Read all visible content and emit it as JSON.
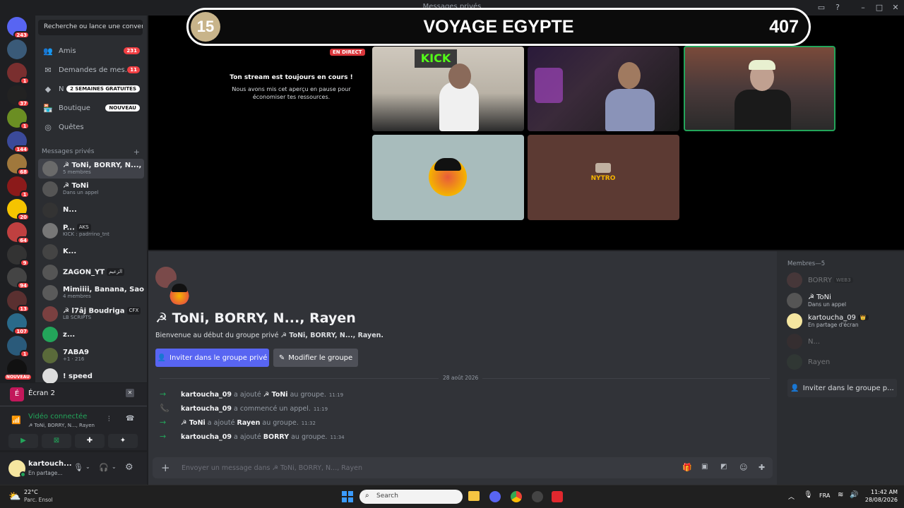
{
  "window": {
    "title": "Messages privés"
  },
  "rail": {
    "servers": [
      {
        "badge": "243",
        "color": "#5865f2",
        "y": 0
      },
      {
        "badge": "",
        "color": "#3a5a78",
        "y": 0
      },
      {
        "badge": "1",
        "color": "#7a2f2f",
        "y": 0
      },
      {
        "badge": "37",
        "color": "#222",
        "y": 0
      },
      {
        "badge": "1",
        "color": "#6b8e23",
        "y": 0
      },
      {
        "badge": "144",
        "color": "#3b4a9a",
        "y": 0
      },
      {
        "badge": "68",
        "color": "#a0783c",
        "y": 0
      },
      {
        "badge": "1",
        "color": "#8b1a1a",
        "y": 0
      },
      {
        "badge": "20",
        "color": "#f5c400",
        "y": 0
      },
      {
        "badge": "64",
        "color": "#c04040",
        "y": 0
      },
      {
        "badge": "9",
        "color": "#333",
        "y": 0
      },
      {
        "badge": "94",
        "color": "#444",
        "y": 0
      },
      {
        "badge": "13",
        "color": "#5a3030",
        "y": 0
      },
      {
        "badge": "107",
        "color": "#2a6a8a",
        "y": 0
      },
      {
        "badge": "1",
        "color": "#2a5a7a",
        "y": 0
      },
      {
        "badge": "NOUVEAU",
        "color": "#111",
        "y": 0
      }
    ]
  },
  "sidebar": {
    "search_placeholder": "Recherche ou lance une conver...",
    "nav": [
      {
        "label": "Amis",
        "badge": "231"
      },
      {
        "label": "Demandes de mes...",
        "badge": "11"
      },
      {
        "label": "N",
        "badge": "2 SEMAINES GRATUITES"
      },
      {
        "label": "Boutique",
        "badge": "NOUVEAU"
      },
      {
        "label": "Quêtes",
        "badge": ""
      }
    ],
    "dm_header": "Messages privés",
    "dms": [
      {
        "name": "☭ ToNi, BORRY, N..., R...",
        "sub": "5 membres",
        "tag": "",
        "color": "#6a6a6a"
      },
      {
        "name": "☭ ToNi",
        "sub": "Dans un appel",
        "tag": "",
        "color": "#555"
      },
      {
        "name": "N...",
        "sub": "",
        "tag": "",
        "color": "#333"
      },
      {
        "name": "P...",
        "sub": "KICK : padrrino_tnt",
        "tag": "AKS",
        "color": "#777"
      },
      {
        "name": "K...",
        "sub": "",
        "tag": "",
        "color": "#444"
      },
      {
        "name": "ZAGON_YT",
        "sub": "",
        "tag": "الزعيم",
        "color": "#555"
      },
      {
        "name": "Mimiiii, Banana, Saoud...",
        "sub": "4 membres",
        "tag": "",
        "color": "#5a5a5a"
      },
      {
        "name": "☭ l7âj Boudriga",
        "sub": "LB SCRIPTS",
        "tag": "CFX",
        "color": "#7a4040"
      },
      {
        "name": "z...",
        "sub": "",
        "tag": "",
        "color": "#23a55a"
      },
      {
        "name": "7ABA9",
        "sub": "+1 · 216",
        "tag": "",
        "color": "#5a6a3a"
      },
      {
        "name": "! speed",
        "sub": "",
        "tag": "",
        "color": "#ddd"
      }
    ]
  },
  "voice": {
    "screen_label": "Écran 2",
    "status": "Vidéo connectée",
    "channel": "☭ ToNi, BORRY, N..., Rayen"
  },
  "user": {
    "name": "kartouch...",
    "status": "En partage..."
  },
  "stage": {
    "banner_left": "15",
    "banner_title": "VOYAGE EGYPTE",
    "banner_right": "407",
    "live_badge": "EN DIRECT",
    "paused_title": "Ton stream est toujours en cours !",
    "paused_text": "Nous avons mis cet aperçu en pause pour économiser tes ressources.",
    "nytro_label": "NYTRO"
  },
  "chat": {
    "group_title": "☭ ToNi, BORRY, N..., Rayen",
    "intro_prefix": "Bienvenue au début du groupe privé ",
    "intro_name": "☭ ToNi, BORRY, N..., Rayen.",
    "invite_button": "Inviter dans le groupe privé",
    "edit_button": "Modifier le groupe",
    "date_divider": "28 août 2026",
    "messages": [
      {
        "actor": "kartoucha_09",
        "action": " a ajouté ",
        "target": "☭ ToNi",
        "rest": " au groupe.",
        "time": "11:19",
        "kind": "add"
      },
      {
        "actor": "kartoucha_09",
        "action": " a commencé un appel.",
        "target": "",
        "rest": "",
        "time": "11:19",
        "kind": "call"
      },
      {
        "actor": "☭ ToNi",
        "action": " a ajouté ",
        "target": "Rayen",
        "rest": " au groupe.",
        "time": "11:32",
        "kind": "add"
      },
      {
        "actor": "kartoucha_09",
        "action": " a ajouté ",
        "target": "BORRY",
        "rest": " au groupe.",
        "time": "11:34",
        "kind": "add"
      }
    ],
    "composer_placeholder": "Envoyer un message dans ☭ ToNi, BORRY, N..., Rayen"
  },
  "members": {
    "header": "Membres—5",
    "list": [
      {
        "name": "BORRY",
        "sub": "",
        "tag": "WEB3",
        "dim": true,
        "color": "#7a4a4a"
      },
      {
        "name": "☭ ToNi",
        "sub": "Dans un appel",
        "tag": "",
        "dim": false,
        "color": "#555"
      },
      {
        "name": "kartoucha_09",
        "sub": "En partage d'écran",
        "tag": "👑",
        "dim": false,
        "color": "#f5e6a0"
      },
      {
        "name": "N...",
        "sub": "",
        "tag": "",
        "dim": true,
        "color": "#4a3030"
      },
      {
        "name": "Rayen",
        "sub": "",
        "tag": "",
        "dim": true,
        "color": "#3a4a3a"
      }
    ],
    "invite_button": "Inviter dans le groupe p..."
  },
  "taskbar": {
    "weather_temp": "22°C",
    "weather_desc": "Parc. Ensol",
    "search": "Search",
    "lang": "FRA",
    "time": "11:42 AM",
    "date": "28/08/2026"
  }
}
